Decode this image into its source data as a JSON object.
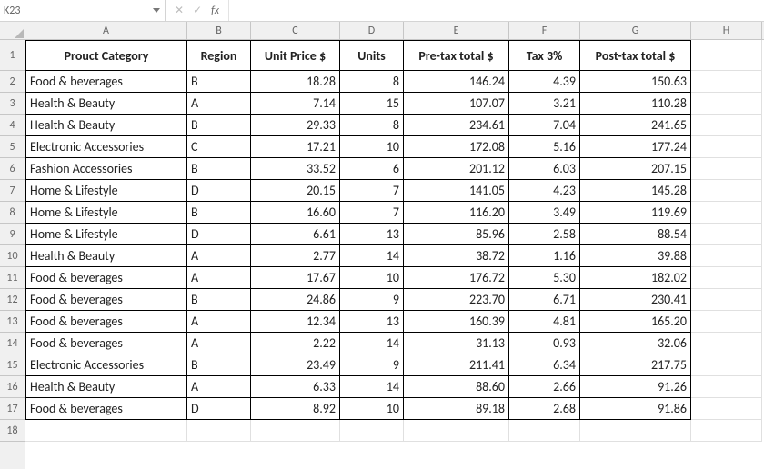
{
  "formula_bar": {
    "name_box": "K23",
    "cancel_label": "✕",
    "confirm_label": "✓",
    "fx_label": "fx",
    "input_value": ""
  },
  "columns": [
    "A",
    "B",
    "C",
    "D",
    "E",
    "F",
    "G",
    "H"
  ],
  "rows": [
    "1",
    "2",
    "3",
    "4",
    "5",
    "6",
    "7",
    "8",
    "9",
    "10",
    "11",
    "12",
    "13",
    "14",
    "15",
    "16",
    "17",
    "18"
  ],
  "headers": {
    "A": "Prouct Category",
    "B": "Region",
    "C": "Unit Price $",
    "D": "Units",
    "E": "Pre-tax total $",
    "F": "Tax 3%",
    "G": "Post-tax total $"
  },
  "data": [
    {
      "A": "Food & beverages",
      "B": "B",
      "C": "18.28",
      "D": "8",
      "E": "146.24",
      "F": "4.39",
      "G": "150.63"
    },
    {
      "A": "Health & Beauty",
      "B": "A",
      "C": "7.14",
      "D": "15",
      "E": "107.07",
      "F": "3.21",
      "G": "110.28"
    },
    {
      "A": "Health & Beauty",
      "B": "B",
      "C": "29.33",
      "D": "8",
      "E": "234.61",
      "F": "7.04",
      "G": "241.65"
    },
    {
      "A": "Electronic Accessories",
      "B": "C",
      "C": "17.21",
      "D": "10",
      "E": "172.08",
      "F": "5.16",
      "G": "177.24"
    },
    {
      "A": "Fashion Accessories",
      "B": "B",
      "C": "33.52",
      "D": "6",
      "E": "201.12",
      "F": "6.03",
      "G": "207.15"
    },
    {
      "A": "Home & Lifestyle",
      "B": "D",
      "C": "20.15",
      "D": "7",
      "E": "141.05",
      "F": "4.23",
      "G": "145.28"
    },
    {
      "A": "Home & Lifestyle",
      "B": "B",
      "C": "16.60",
      "D": "7",
      "E": "116.20",
      "F": "3.49",
      "G": "119.69"
    },
    {
      "A": "Home & Lifestyle",
      "B": "D",
      "C": "6.61",
      "D": "13",
      "E": "85.96",
      "F": "2.58",
      "G": "88.54"
    },
    {
      "A": "Health & Beauty",
      "B": "A",
      "C": "2.77",
      "D": "14",
      "E": "38.72",
      "F": "1.16",
      "G": "39.88"
    },
    {
      "A": "Food & beverages",
      "B": "A",
      "C": "17.67",
      "D": "10",
      "E": "176.72",
      "F": "5.30",
      "G": "182.02"
    },
    {
      "A": "Food & beverages",
      "B": "B",
      "C": "24.86",
      "D": "9",
      "E": "223.70",
      "F": "6.71",
      "G": "230.41"
    },
    {
      "A": "Food & beverages",
      "B": "A",
      "C": "12.34",
      "D": "13",
      "E": "160.39",
      "F": "4.81",
      "G": "165.20"
    },
    {
      "A": "Food & beverages",
      "B": "A",
      "C": "2.22",
      "D": "14",
      "E": "31.13",
      "F": "0.93",
      "G": "32.06"
    },
    {
      "A": "Electronic Accessories",
      "B": "B",
      "C": "23.49",
      "D": "9",
      "E": "211.41",
      "F": "6.34",
      "G": "217.75"
    },
    {
      "A": "Health & Beauty",
      "B": "A",
      "C": "6.33",
      "D": "14",
      "E": "88.60",
      "F": "2.66",
      "G": "91.26"
    },
    {
      "A": "Food & beverages",
      "B": "D",
      "C": "8.92",
      "D": "10",
      "E": "89.18",
      "F": "2.68",
      "G": "91.86"
    }
  ],
  "chart_data": {
    "type": "table",
    "columns": [
      "Prouct Category",
      "Region",
      "Unit Price $",
      "Units",
      "Pre-tax total $",
      "Tax 3%",
      "Post-tax total $"
    ],
    "rows": [
      [
        "Food & beverages",
        "B",
        18.28,
        8,
        146.24,
        4.39,
        150.63
      ],
      [
        "Health & Beauty",
        "A",
        7.14,
        15,
        107.07,
        3.21,
        110.28
      ],
      [
        "Health & Beauty",
        "B",
        29.33,
        8,
        234.61,
        7.04,
        241.65
      ],
      [
        "Electronic Accessories",
        "C",
        17.21,
        10,
        172.08,
        5.16,
        177.24
      ],
      [
        "Fashion Accessories",
        "B",
        33.52,
        6,
        201.12,
        6.03,
        207.15
      ],
      [
        "Home & Lifestyle",
        "D",
        20.15,
        7,
        141.05,
        4.23,
        145.28
      ],
      [
        "Home & Lifestyle",
        "B",
        16.6,
        7,
        116.2,
        3.49,
        119.69
      ],
      [
        "Home & Lifestyle",
        "D",
        6.61,
        13,
        85.96,
        2.58,
        88.54
      ],
      [
        "Health & Beauty",
        "A",
        2.77,
        14,
        38.72,
        1.16,
        39.88
      ],
      [
        "Food & beverages",
        "A",
        17.67,
        10,
        176.72,
        5.3,
        182.02
      ],
      [
        "Food & beverages",
        "B",
        24.86,
        9,
        223.7,
        6.71,
        230.41
      ],
      [
        "Food & beverages",
        "A",
        12.34,
        13,
        160.39,
        4.81,
        165.2
      ],
      [
        "Food & beverages",
        "A",
        2.22,
        14,
        31.13,
        0.93,
        32.06
      ],
      [
        "Electronic Accessories",
        "B",
        23.49,
        9,
        211.41,
        6.34,
        217.75
      ],
      [
        "Health & Beauty",
        "A",
        6.33,
        14,
        88.6,
        2.66,
        91.26
      ],
      [
        "Food & beverages",
        "D",
        8.92,
        10,
        89.18,
        2.68,
        91.86
      ]
    ]
  }
}
